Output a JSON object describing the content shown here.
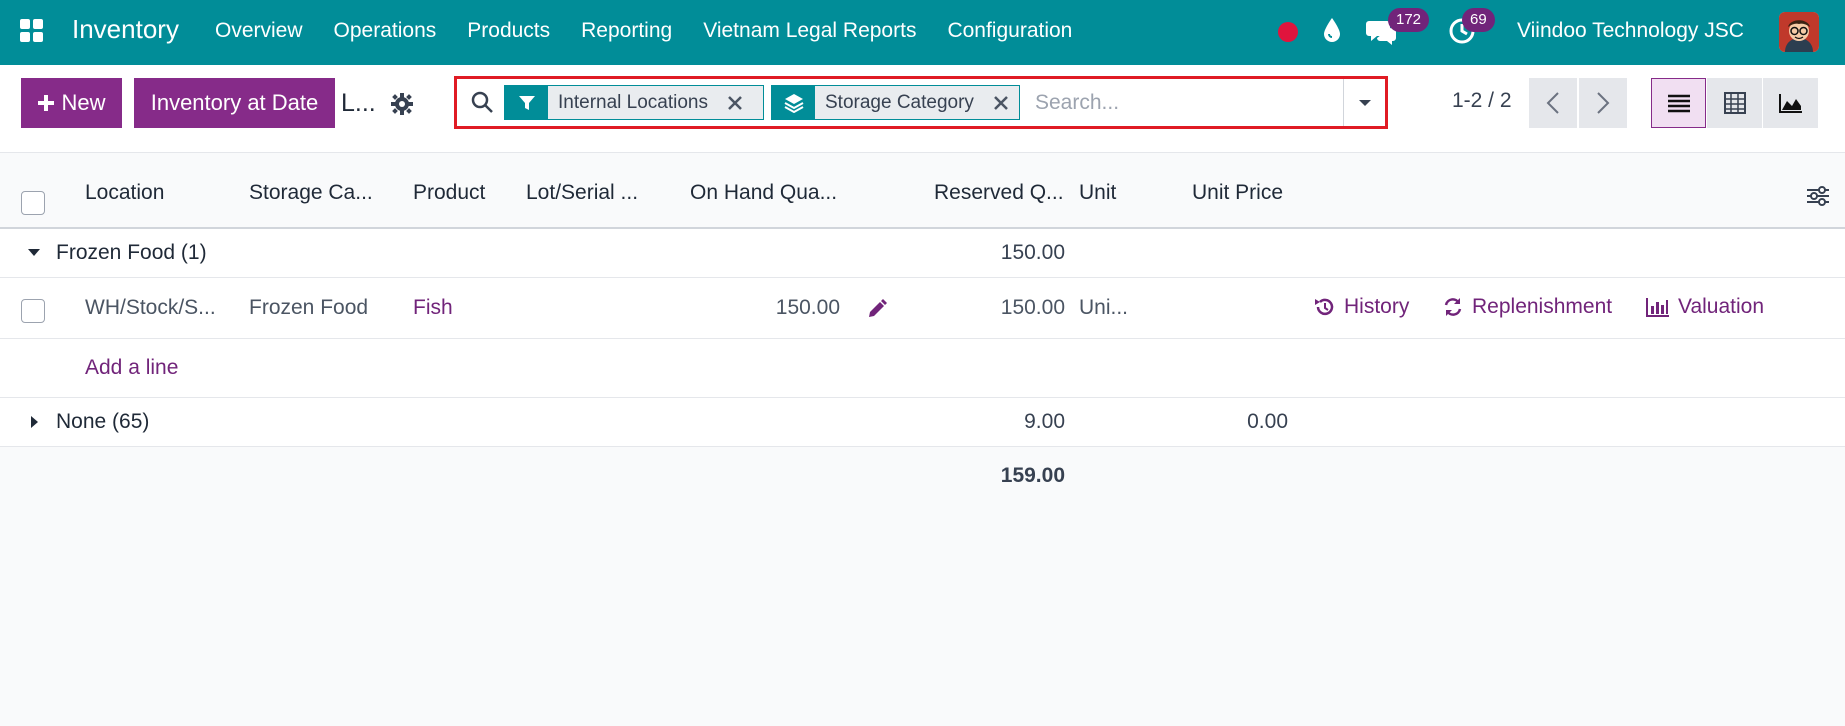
{
  "navbar": {
    "brand": "Inventory",
    "menu": [
      "Overview",
      "Operations",
      "Products",
      "Reporting",
      "Vietnam Legal Reports",
      "Configuration"
    ],
    "messages_count": "172",
    "activities_count": "69",
    "company": "Viindoo Technology JSC",
    "colors": {
      "bar": "#018d98",
      "record": "#e0143d",
      "badge": "#71247a"
    },
    "icons": [
      "apps-grid-icon",
      "record-dot-icon",
      "drop-icon",
      "chat-icon",
      "clock-icon",
      "avatar"
    ]
  },
  "control": {
    "new_label": "New",
    "inventory_at_date_label": "Inventory at Date",
    "breadcrumb": "L...",
    "search": {
      "facets": [
        {
          "icon": "filter-icon",
          "label": "Internal Locations"
        },
        {
          "icon": "layers-icon",
          "label": "Storage Category"
        }
      ],
      "placeholder": "Search..."
    },
    "pager": "1-2 / 2",
    "accent": "#862b89"
  },
  "table": {
    "columns": [
      "Location",
      "Storage Ca...",
      "Product",
      "Lot/Serial ...",
      "On Hand Qua...",
      "Reserved Q...",
      "Unit",
      "Unit Price"
    ],
    "groups": [
      {
        "label": "Frozen Food (1)",
        "expanded": true,
        "reserved_total": "150.00",
        "rows": [
          {
            "location": "WH/Stock/S...",
            "storage_category": "Frozen Food",
            "product": "Fish",
            "on_hand": "150.00",
            "reserved": "150.00",
            "unit": "Uni...",
            "actions": [
              "History",
              "Replenishment",
              "Valuation"
            ]
          }
        ],
        "add_line": "Add a line"
      },
      {
        "label": "None (65)",
        "expanded": false,
        "reserved_total": "9.00",
        "unit_price_total": "0.00"
      }
    ],
    "grand_total": "159.00"
  }
}
